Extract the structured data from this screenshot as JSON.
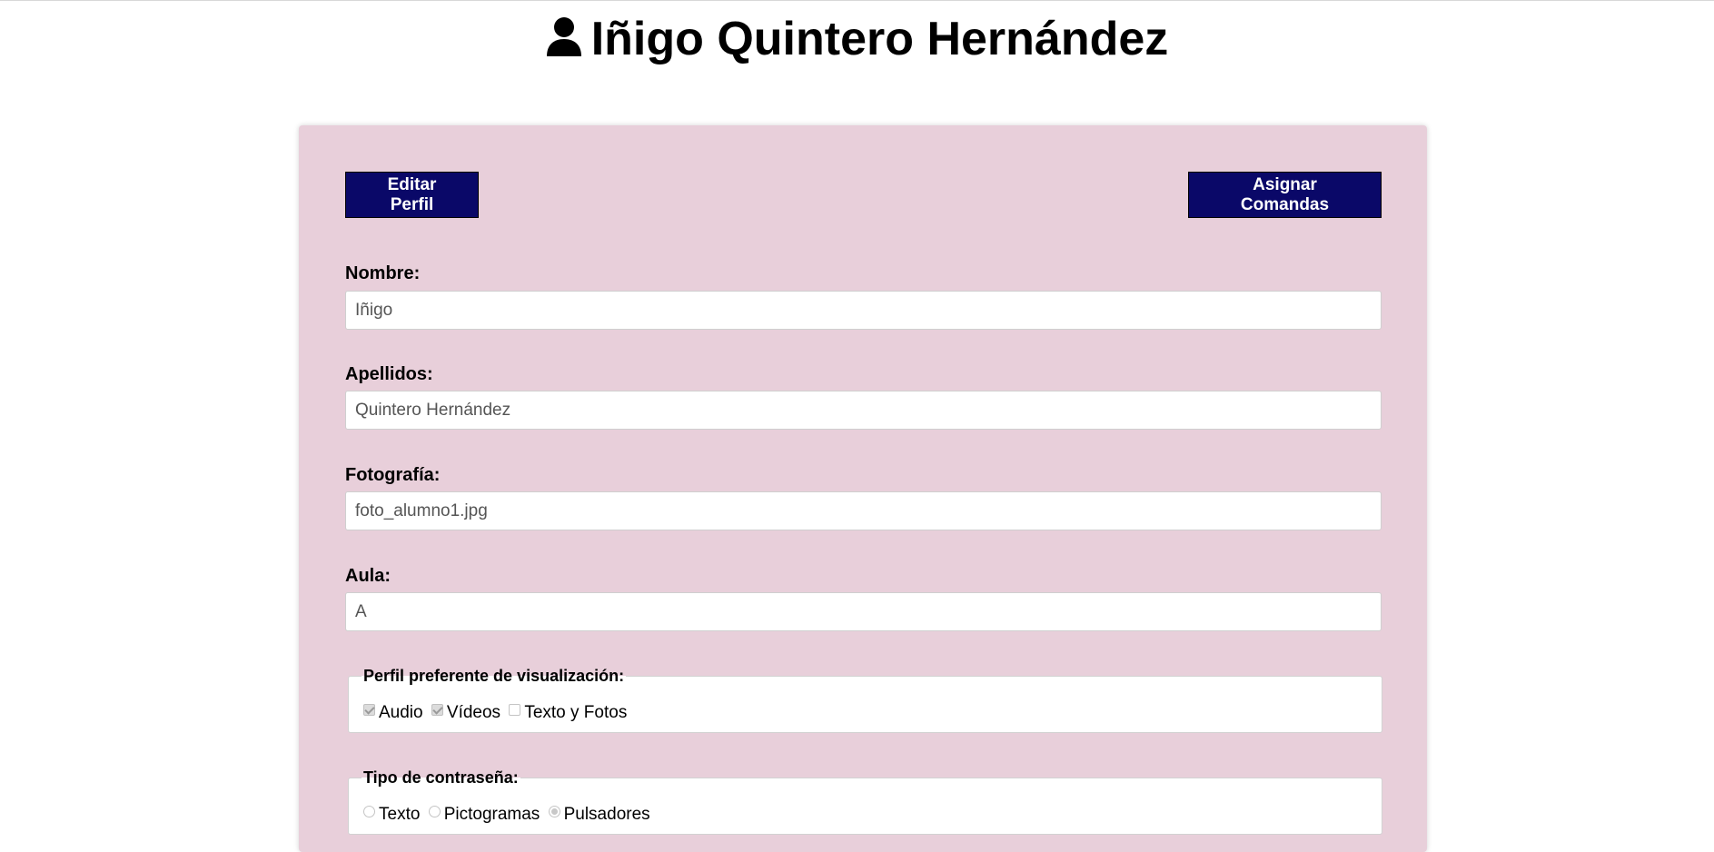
{
  "header": {
    "title": "Iñigo Quintero Hernández",
    "icon": "user-icon"
  },
  "toolbar": {
    "edit_label": "Editar Perfil",
    "assign_label": "Asignar Comandas"
  },
  "form": {
    "nombre": {
      "label": "Nombre:",
      "value": "Iñigo"
    },
    "apellidos": {
      "label": "Apellidos:",
      "value": "Quintero Hernández"
    },
    "fotografia": {
      "label": "Fotografía:",
      "value": "foto_alumno1.jpg"
    },
    "aula": {
      "label": "Aula:",
      "value": "A"
    },
    "visualizacion": {
      "legend": "Perfil preferente de visualización:",
      "options": [
        {
          "label": "Audio",
          "checked": true
        },
        {
          "label": "Vídeos",
          "checked": true
        },
        {
          "label": "Texto y Fotos",
          "checked": false
        }
      ]
    },
    "contrasena": {
      "legend": "Tipo de contraseña:",
      "options": [
        {
          "label": "Texto",
          "checked": false
        },
        {
          "label": "Pictogramas",
          "checked": false
        },
        {
          "label": "Pulsadores",
          "checked": true
        }
      ]
    }
  },
  "colors": {
    "card_background": "#e8cfda",
    "button_background": "#0a0868",
    "button_text": "#ffffff"
  }
}
